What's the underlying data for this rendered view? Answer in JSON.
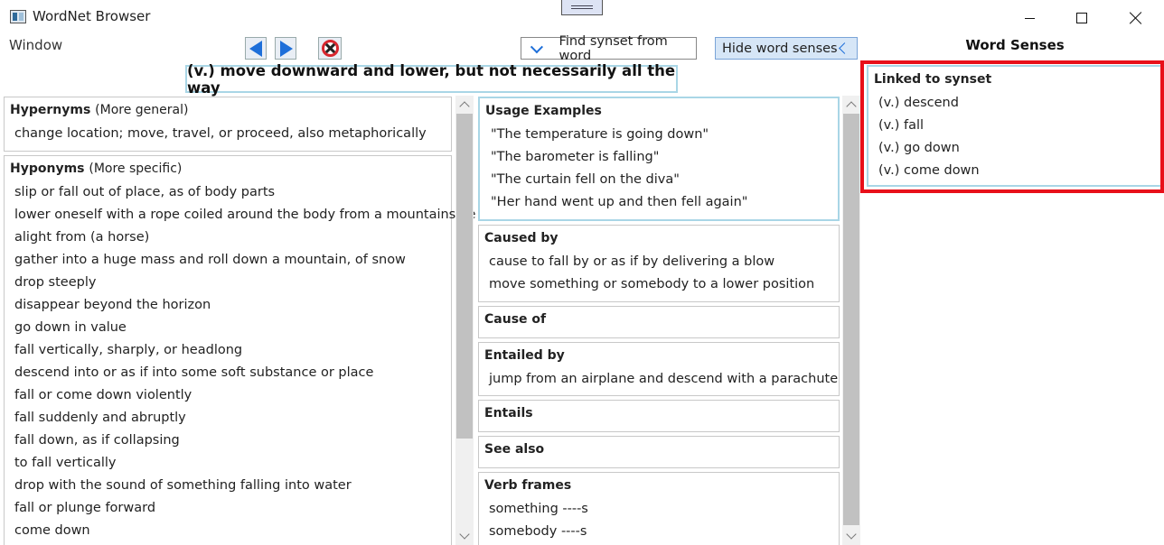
{
  "window": {
    "title": "WordNet Browser"
  },
  "menu": {
    "window_label": "Window"
  },
  "toolbar": {
    "find_label": "Find synset from word",
    "hide_label": "Hide word senses"
  },
  "definition": "(v.) move downward and lower, but not necessarily all the way",
  "hypernyms": {
    "title": "Hypernyms",
    "subtitle": "(More general)",
    "items": [
      "change location; move, travel, or proceed, also metaphorically"
    ]
  },
  "hyponyms": {
    "title": "Hyponyms",
    "subtitle": "(More specific)",
    "items": [
      "slip or fall out of place, as of body parts",
      "lower oneself with a rope coiled around the body from a mountainside",
      "alight from (a horse)",
      "gather into a huge mass and roll down a mountain, of snow",
      "drop steeply",
      "disappear beyond the horizon",
      "go down in value",
      "fall vertically, sharply, or headlong",
      "descend into or as if into some soft substance or place",
      "fall or come down violently",
      "fall suddenly and abruptly",
      "fall down, as if collapsing",
      "to fall vertically",
      "drop with the sound of something falling into water",
      "fall or plunge forward",
      "come down"
    ]
  },
  "usage_examples": {
    "title": "Usage Examples",
    "items": [
      "\"The temperature is going down\"",
      "\"The barometer is falling\"",
      "\"The curtain fell on the diva\"",
      "\"Her hand went up and then fell again\""
    ]
  },
  "caused_by": {
    "title": "Caused by",
    "items": [
      "cause to fall by or as if by delivering a blow",
      "move something or somebody to a lower position"
    ]
  },
  "cause_of": {
    "title": "Cause of"
  },
  "entailed_by": {
    "title": "Entailed by",
    "items": [
      "jump from an airplane and descend with a parachute"
    ]
  },
  "entails": {
    "title": "Entails"
  },
  "see_also": {
    "title": "See also"
  },
  "verb_frames": {
    "title": "Verb frames",
    "items": [
      "something ----s",
      "somebody ----s"
    ]
  },
  "word_senses": {
    "title": "Word Senses",
    "linked_title": "Linked to synset",
    "items": [
      "(v.) descend",
      "(v.) fall",
      "(v.) go down",
      "(v.) come down"
    ]
  },
  "colors": {
    "accent_blue": "#1e6fd9",
    "highlight_red": "#e8101a",
    "active_border": "#a9d6e6"
  }
}
